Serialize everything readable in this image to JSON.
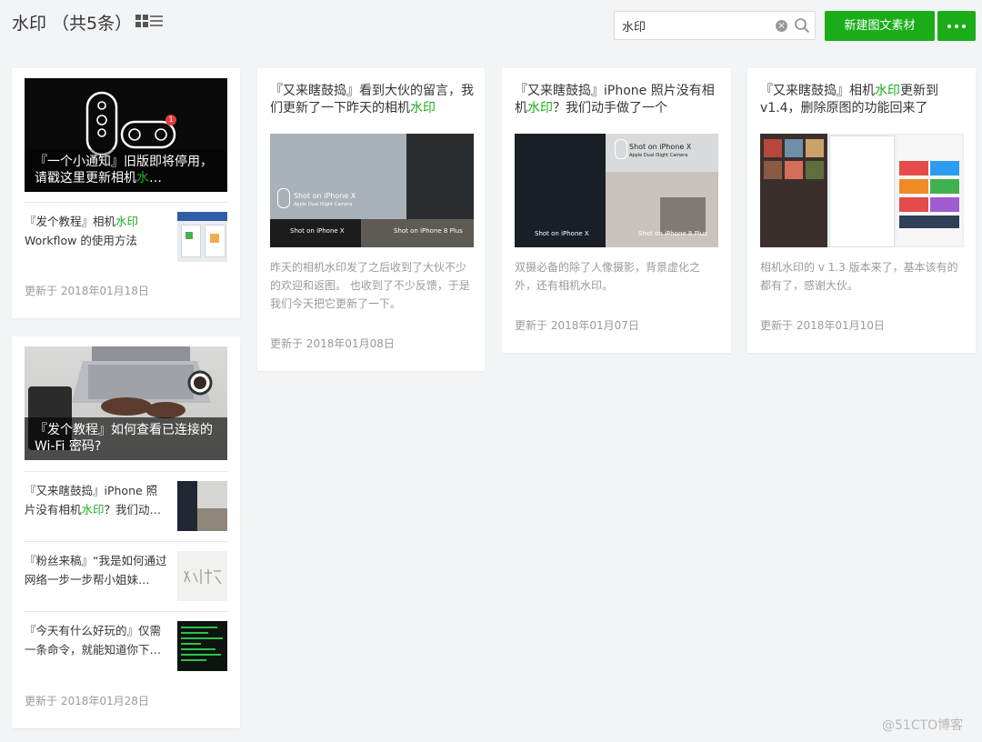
{
  "header": {
    "title": "水印 （共5条）",
    "search_value": "水印",
    "new_button": "新建图文素材"
  },
  "cards": [
    {
      "cover_title": [
        "『一个小通知』旧版即将停用，请戳这里更新相机",
        "水",
        "…"
      ],
      "items": [
        {
          "title": [
            "『发个教程』相机",
            "水印",
            " Workflow 的使用方法"
          ]
        }
      ],
      "date": "更新于 2018年01月18日"
    },
    {
      "cover_title": [
        "『发个教程』如何查看已连接的 Wi-Fi 密码?"
      ],
      "items": [
        {
          "title": [
            "『又来瞎鼓捣』iPhone 照片没有相机",
            "水印",
            "？我们动…"
          ]
        },
        {
          "title": [
            "『粉丝来稿』“我是如何通过网络一步一步帮小姐妹…"
          ]
        },
        {
          "title": [
            "『今天有什么好玩的』仅需一条命令，就能知道你下…"
          ]
        }
      ],
      "date": "更新于 2018年01月28日"
    },
    {
      "title": [
        "『又来瞎鼓捣』看到大伙的留言，我们更新了一下昨天的相机",
        "水印"
      ],
      "desc": "昨天的相机水印发了之后收到了大伙不少的欢迎和返图。 也收到了不少反馈，于是我们今天把它更新了一下。",
      "thumb_texts": [
        "Shot on iPhone X",
        "Apple Dual iSight Camera",
        "Shot on iPhone X",
        "Shot on iPhone 8 Plus"
      ],
      "date": "更新于 2018年01月08日"
    },
    {
      "title": [
        "『又来瞎鼓捣』iPhone 照片没有相机",
        "水印",
        "？我们动手做了一个"
      ],
      "desc": "双摄必备的除了人像摄影，背景虚化之外，还有相机水印。",
      "thumb_texts": [
        "Shot on iPhone X",
        "Apple Dual iSight Camera",
        "Shot on iPhone X",
        "Shot on iPhone 8 Plus"
      ],
      "date": "更新于 2018年01月07日"
    },
    {
      "title": [
        "『又来瞎鼓捣』相机",
        "水印",
        "更新到 v1.4，删除原图的功能回来了"
      ],
      "desc": "相机水印的 v 1.3 版本来了，基本该有的都有了，感谢大伙。",
      "date": "更新于 2018年01月10日"
    }
  ],
  "cover_badge": "1",
  "watermark": "@51CTO博客",
  "colors": {
    "accent": "#1aad19",
    "background": "#f3f4f6"
  },
  "icons": [
    "grid-view-icon",
    "list-view-icon",
    "clear-icon",
    "search-icon",
    "more-icon"
  ]
}
